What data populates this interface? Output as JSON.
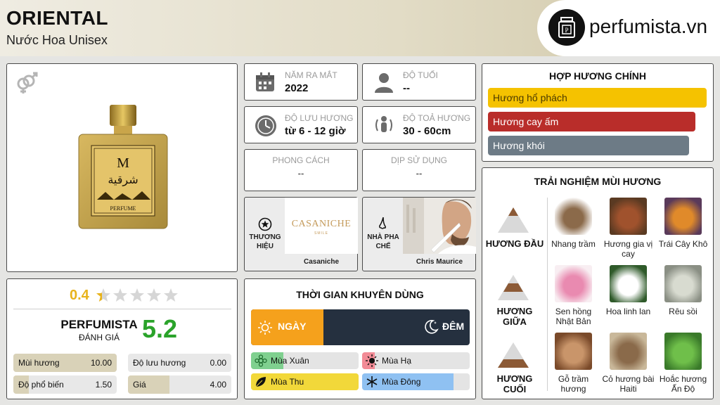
{
  "header": {
    "title": "ORIENTAL",
    "subtitle": "Nước Hoa Unisex",
    "logo_text": "perfumista.vn"
  },
  "icons": {
    "gender": "unisex-gender-icon",
    "logo": "perfume-bottle-icon"
  },
  "product": {
    "bottle_monogram": "M",
    "bottle_name": "شرقية",
    "bottle_brand": "PERFUME"
  },
  "info": {
    "release_year": {
      "label": "NĂM RA MẮT",
      "value": "2022"
    },
    "age": {
      "label": "ĐỘ TUỔI",
      "value": "--"
    },
    "longevity": {
      "label": "ĐỘ LƯU HƯƠNG",
      "value": "từ 6 - 12 giờ"
    },
    "sillage": {
      "label": "ĐỘ TOẢ HƯƠNG",
      "value": "30 - 60cm"
    },
    "style": {
      "label": "PHONG CÁCH",
      "value": "--"
    },
    "occasion": {
      "label": "DỊP SỬ DỤNG",
      "value": "--"
    },
    "brand": {
      "label": "THƯƠNG HIỆU",
      "logo_text": "CASANICHE",
      "logo_sub": "SMILE",
      "name": "Casaniche"
    },
    "perfumer": {
      "label": "NHÀ PHA CHẾ",
      "name": "Chris Maurice"
    }
  },
  "accords": {
    "title": "HỢP HƯƠNG CHÍNH",
    "items": [
      {
        "label": "Hương hổ phách",
        "color": "#f5c200",
        "level": 1.0
      },
      {
        "label": "Hương cay ấm",
        "color": "#b92d2a",
        "level": 0.95
      },
      {
        "label": "Hương khói",
        "color": "#6d7b86",
        "level": 0.92
      }
    ]
  },
  "notes": {
    "title": "TRẢI NGHIỆM MÙI HƯƠNG",
    "tiers": [
      {
        "label": "HƯƠNG ĐẦU",
        "items": [
          "Nhang trầm",
          "Hương gia vị cay",
          "Trái Cây Khô"
        ]
      },
      {
        "label": "HƯƠNG GIỮA",
        "items": [
          "Sen hồng Nhật Bản",
          "Hoa linh lan",
          "Rêu sồi"
        ]
      },
      {
        "label": "HƯƠNG CUỐI",
        "items": [
          "Gỗ trầm hương",
          "Cỏ hương bài Haiti",
          "Hoắc hương Ấn Độ"
        ]
      }
    ]
  },
  "rating": {
    "user_score": "0.4",
    "stars_total": 5,
    "brand": "PERFUMISTA",
    "brand_sub": "ĐÁNH GIÁ",
    "score": "5.2",
    "items": [
      {
        "label": "Mùi hương",
        "value": "10.00",
        "level": 1.0
      },
      {
        "label": "Độ lưu hương",
        "value": "0.00",
        "level": 0.0
      },
      {
        "label": "Độ phổ biến",
        "value": "1.50",
        "level": 0.15
      },
      {
        "label": "Giá",
        "value": "4.00",
        "level": 0.4
      }
    ]
  },
  "usage": {
    "title": "THỜI GIAN KHUYÊN DÙNG",
    "day_label": "NGÀY",
    "night_label": "ĐÊM",
    "day_fraction": 0.33,
    "seasons": [
      {
        "label": "Mùa Xuân",
        "level": 0.3,
        "color": "#7fd08f"
      },
      {
        "label": "Mùa Hạ",
        "level": 0.12,
        "color": "#f28b96"
      },
      {
        "label": "Mùa Thu",
        "level": 1.0,
        "color": "#f2d83a"
      },
      {
        "label": "Mùa Đông",
        "level": 0.85,
        "color": "#8fc1f2"
      }
    ]
  }
}
